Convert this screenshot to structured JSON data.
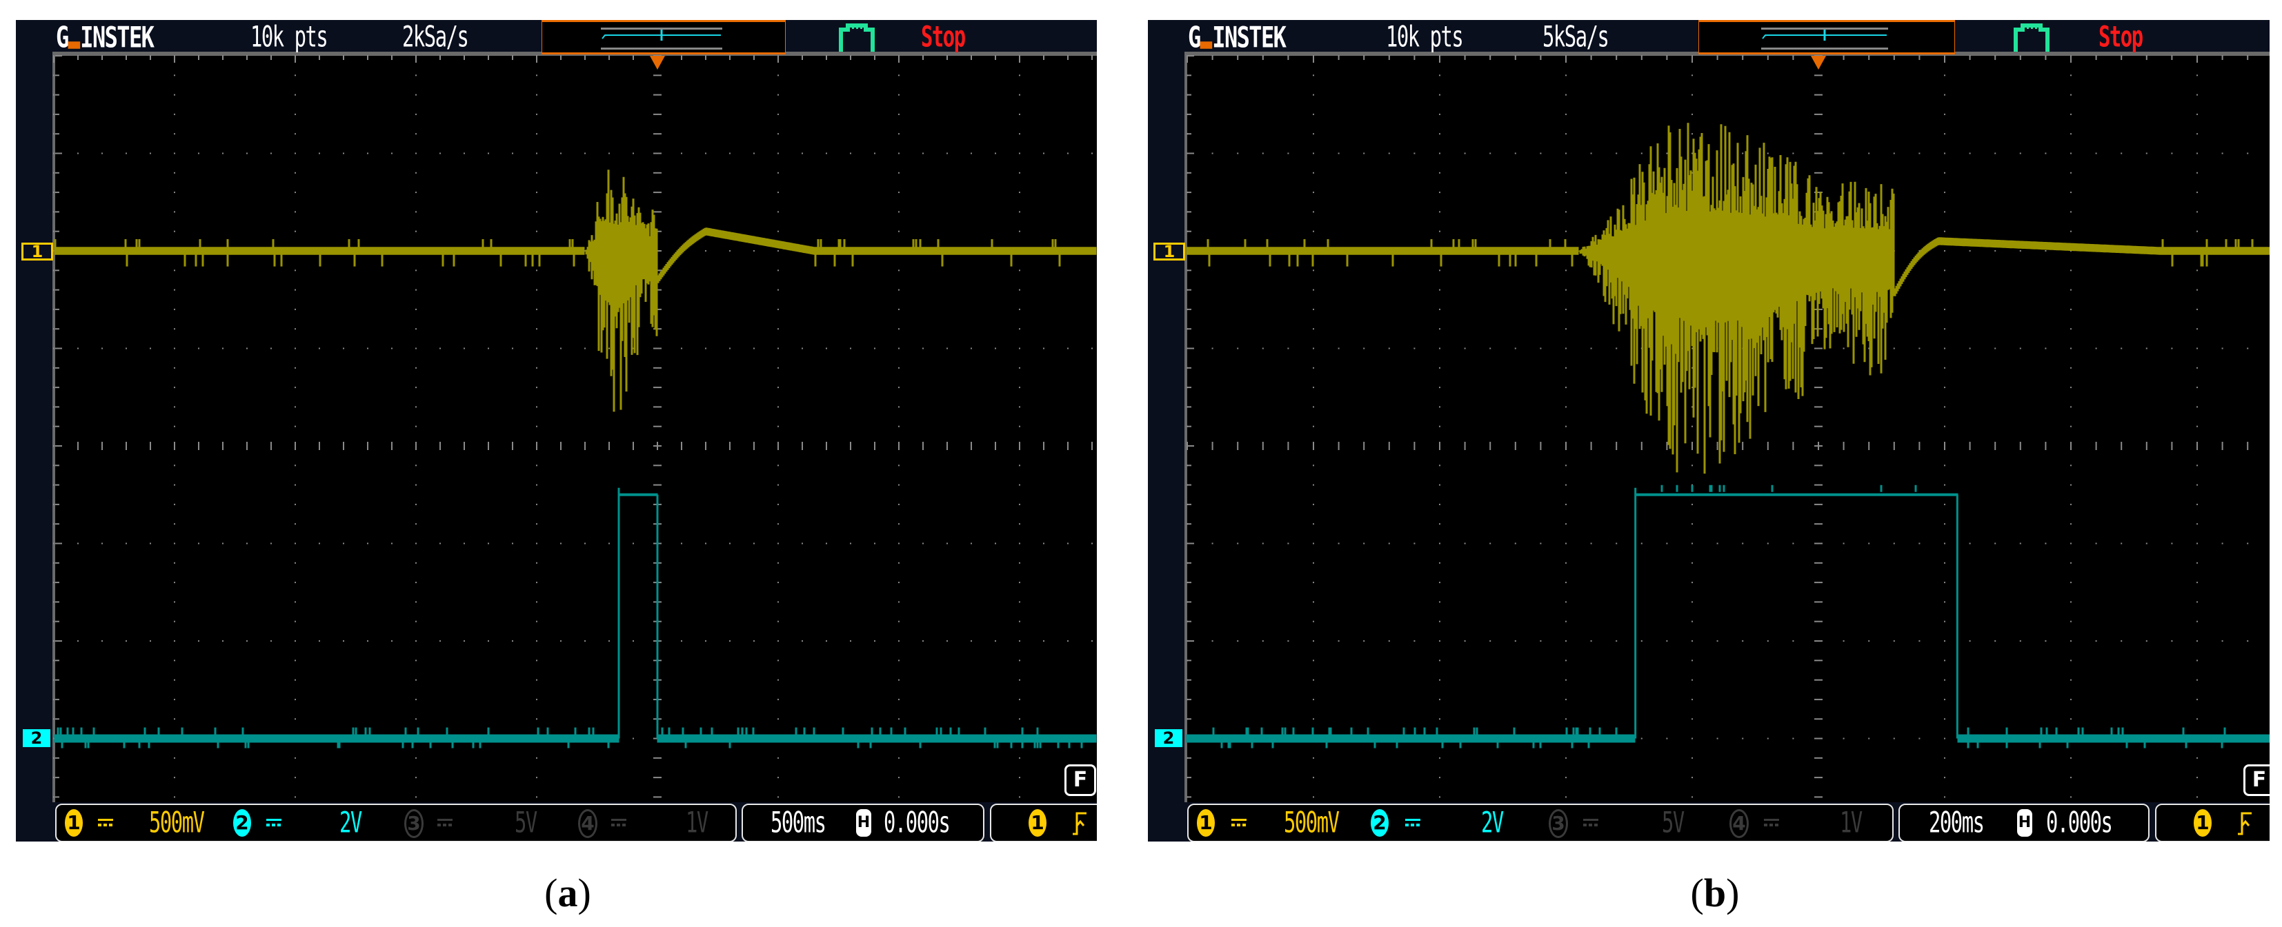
{
  "colors": {
    "screen_bg": "#0a0f1e",
    "grid_bg": "#000000",
    "grid": "#8a8a8a",
    "ch1_trace": "#9a9400",
    "ch1_label": "#ffcc00",
    "ch2_trace": "#00918c",
    "ch2_label": "#00ffff",
    "inactive_channel": "#3a3a3a",
    "accent_orange": "#e86a00",
    "stop_red": "#ff1a1a",
    "trigger_green": "#22e39a"
  },
  "panels": [
    {
      "caption_open": "(",
      "caption_letter": "a",
      "caption_close": ")",
      "header": {
        "brand_left": "G",
        "brand_right": "INSTEK",
        "record_length": "10k pts",
        "sample_rate": "2kSa/s",
        "run_state": "Stop"
      },
      "channels": [
        {
          "number": "1",
          "scale": "500mV",
          "active": true
        },
        {
          "number": "2",
          "scale": "2V",
          "active": true
        },
        {
          "number": "3",
          "scale": "5V",
          "active": false
        },
        {
          "number": "4",
          "scale": "1V",
          "active": false
        }
      ],
      "timebase": {
        "scale": "500ms",
        "position": "0.000s",
        "mode_icon": "H"
      },
      "trigger": {
        "source": "1",
        "slope_icon": "rising-edge"
      },
      "badge": "F"
    },
    {
      "caption_open": "(",
      "caption_letter": "b",
      "caption_close": ")",
      "header": {
        "brand_left": "G",
        "brand_right": "INSTEK",
        "record_length": "10k pts",
        "sample_rate": "5kSa/s",
        "run_state": "Stop"
      },
      "channels": [
        {
          "number": "1",
          "scale": "500mV",
          "active": true
        },
        {
          "number": "2",
          "scale": "2V",
          "active": true
        },
        {
          "number": "3",
          "scale": "5V",
          "active": false
        },
        {
          "number": "4",
          "scale": "1V",
          "active": false
        }
      ],
      "timebase": {
        "scale": "200ms",
        "position": "0.000s",
        "mode_icon": "H"
      },
      "trigger": {
        "source": "1",
        "slope_icon": "rising-edge"
      },
      "badge": "F"
    }
  ],
  "chart_data": [
    {
      "type": "line",
      "title": "(a)",
      "x_unit": "s",
      "time_per_div_s": 0.5,
      "x_visible_divisions": [
        -5,
        3.6
      ],
      "y_visible_divisions": [
        -3.65,
        4
      ],
      "series": [
        {
          "name": "CH1",
          "volts_per_div": 0.5,
          "baseline_v": 0,
          "burst": {
            "start_s": -0.3,
            "end_s": 0.0,
            "peak_pos_v": 0.45,
            "peak_neg_v": -0.88
          },
          "after_dip_v": -0.15,
          "after_bump": {
            "at_s": 0.2,
            "v": 0.1,
            "settle_s": 0.45
          }
        },
        {
          "name": "CH2",
          "volts_per_div": 2,
          "low_v": 0,
          "high_v": 5.0,
          "pulse": {
            "start_s": -0.16,
            "end_s": 0.0
          }
        }
      ]
    },
    {
      "type": "line",
      "title": "(b)",
      "x_unit": "s",
      "time_per_div_s": 0.2,
      "x_visible_divisions": [
        -5,
        3.55
      ],
      "y_visible_divisions": [
        -3.65,
        4
      ],
      "series": [
        {
          "name": "CH1",
          "volts_per_div": 0.5,
          "baseline_v": 0,
          "burst": {
            "start_s": -0.38,
            "end_s": 0.12,
            "peak_pos_v": 0.67,
            "peak_neg_v": -1.16
          },
          "after_dip_v": -0.22,
          "after_bump": {
            "at_s": 0.19,
            "v": 0.05,
            "settle_s": 0.35
          }
        },
        {
          "name": "CH2",
          "volts_per_div": 2,
          "low_v": 0,
          "high_v": 5.0,
          "pulse": {
            "start_s": -0.29,
            "end_s": 0.22
          }
        }
      ]
    }
  ]
}
